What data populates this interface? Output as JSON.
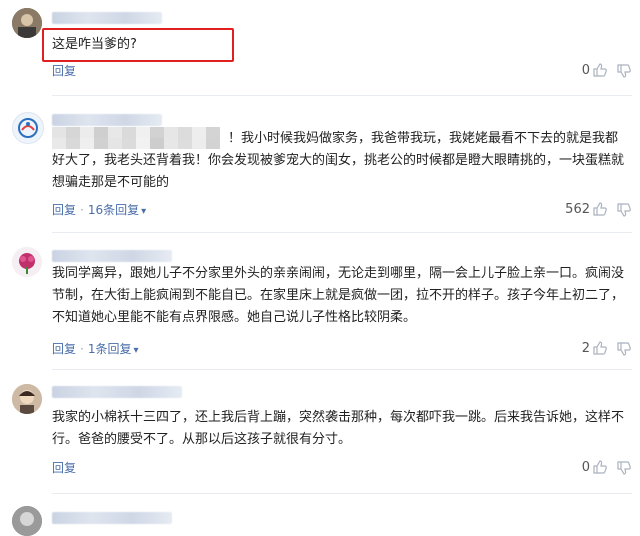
{
  "comments": [
    {
      "text": "这是咋当爹的?",
      "reply_label": "回复",
      "likes": "0"
    },
    {
      "text_line1": "！我小时候我妈做家务，我爸带我玩，我姥姥最看不下去的就是我都",
      "text_rest": "好大了，我老头还背着我！你会发现被爹宠大的闺女，挑老公的时候都是瞪大眼睛挑的，一块蛋糕就\n想骗走那是不可能的",
      "reply_label": "回复",
      "replies_label": "16条回复",
      "likes": "562"
    },
    {
      "text": "我同学离异，跟她儿子不分家里外头的亲亲闹闹，无论走到哪里，隔一会上儿子脸上亲一口。疯闹没\n节制，在大街上能疯闹到不能自已。在家里床上就是疯做一团，拉不开的样子。孩子今年上初二了，\n不知道她心里能不能有点界限感。她自己说儿子性格比较阴柔。",
      "reply_label": "回复",
      "replies_label": "1条回复",
      "likes": "2"
    },
    {
      "text": "我家的小棉袄十三四了，还上我后背上蹦，突然袭击那种，每次都吓我一跳。后来我告诉她，这样不\n行。爸爸的腰受不了。从那以后这孩子就很有分寸。",
      "reply_label": "回复",
      "likes": "0"
    }
  ],
  "icons": {
    "like": "thumbs-up-icon",
    "dislike": "thumbs-down-icon",
    "caret": "chevron-down-icon"
  },
  "colors": {
    "link": "#4a6ea9",
    "highlight": "#e02020",
    "divider": "#e9ecf0"
  }
}
